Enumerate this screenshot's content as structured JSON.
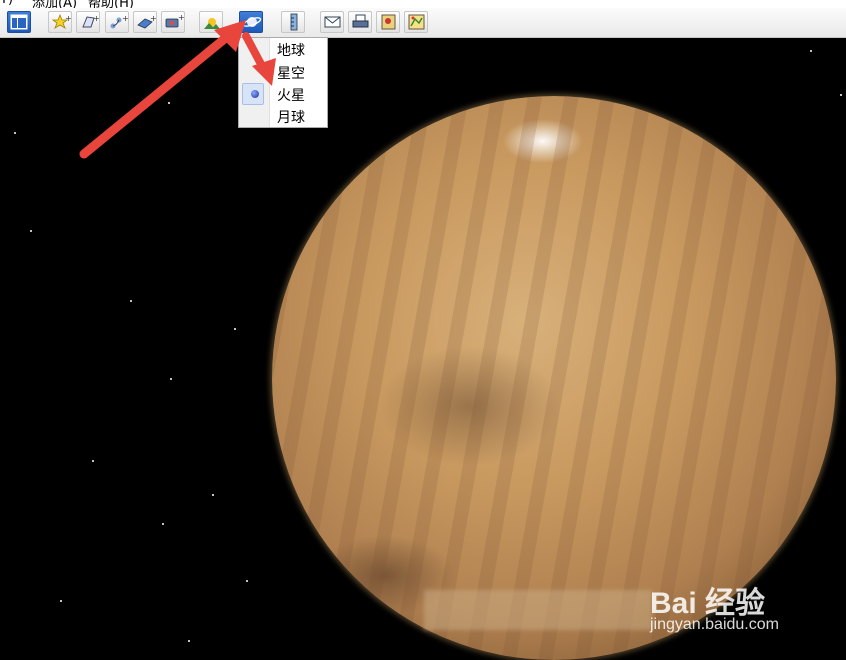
{
  "menubar": {
    "items": [
      {
        "label": "T)"
      },
      {
        "label": "添加(A)"
      },
      {
        "label": "帮助(H)"
      }
    ]
  },
  "toolbar": {
    "buttons": [
      {
        "icon": "sidebar-icon"
      },
      {
        "icon": "placemark-icon"
      },
      {
        "icon": "polygon-icon"
      },
      {
        "icon": "path-icon"
      },
      {
        "icon": "image-overlay-icon"
      },
      {
        "icon": "record-tour-icon"
      },
      {
        "icon": "sunlight-icon"
      },
      {
        "icon": "planet-icon"
      },
      {
        "icon": "ruler-icon"
      },
      {
        "icon": "email-icon"
      },
      {
        "icon": "print-icon"
      },
      {
        "icon": "save-image-icon"
      },
      {
        "icon": "view-in-maps-icon"
      }
    ]
  },
  "planet_menu": {
    "items": [
      {
        "label": "地球",
        "selected": false
      },
      {
        "label": "星空",
        "selected": false
      },
      {
        "label": "火星",
        "selected": true
      },
      {
        "label": "月球",
        "selected": false
      }
    ]
  },
  "watermark": {
    "logo": "Bai 经验",
    "url": "jingyan.baidu.com"
  },
  "colors": {
    "accent": "#1c58b8",
    "annotation_arrow": "#e8453c",
    "mars": "#c99a60"
  }
}
